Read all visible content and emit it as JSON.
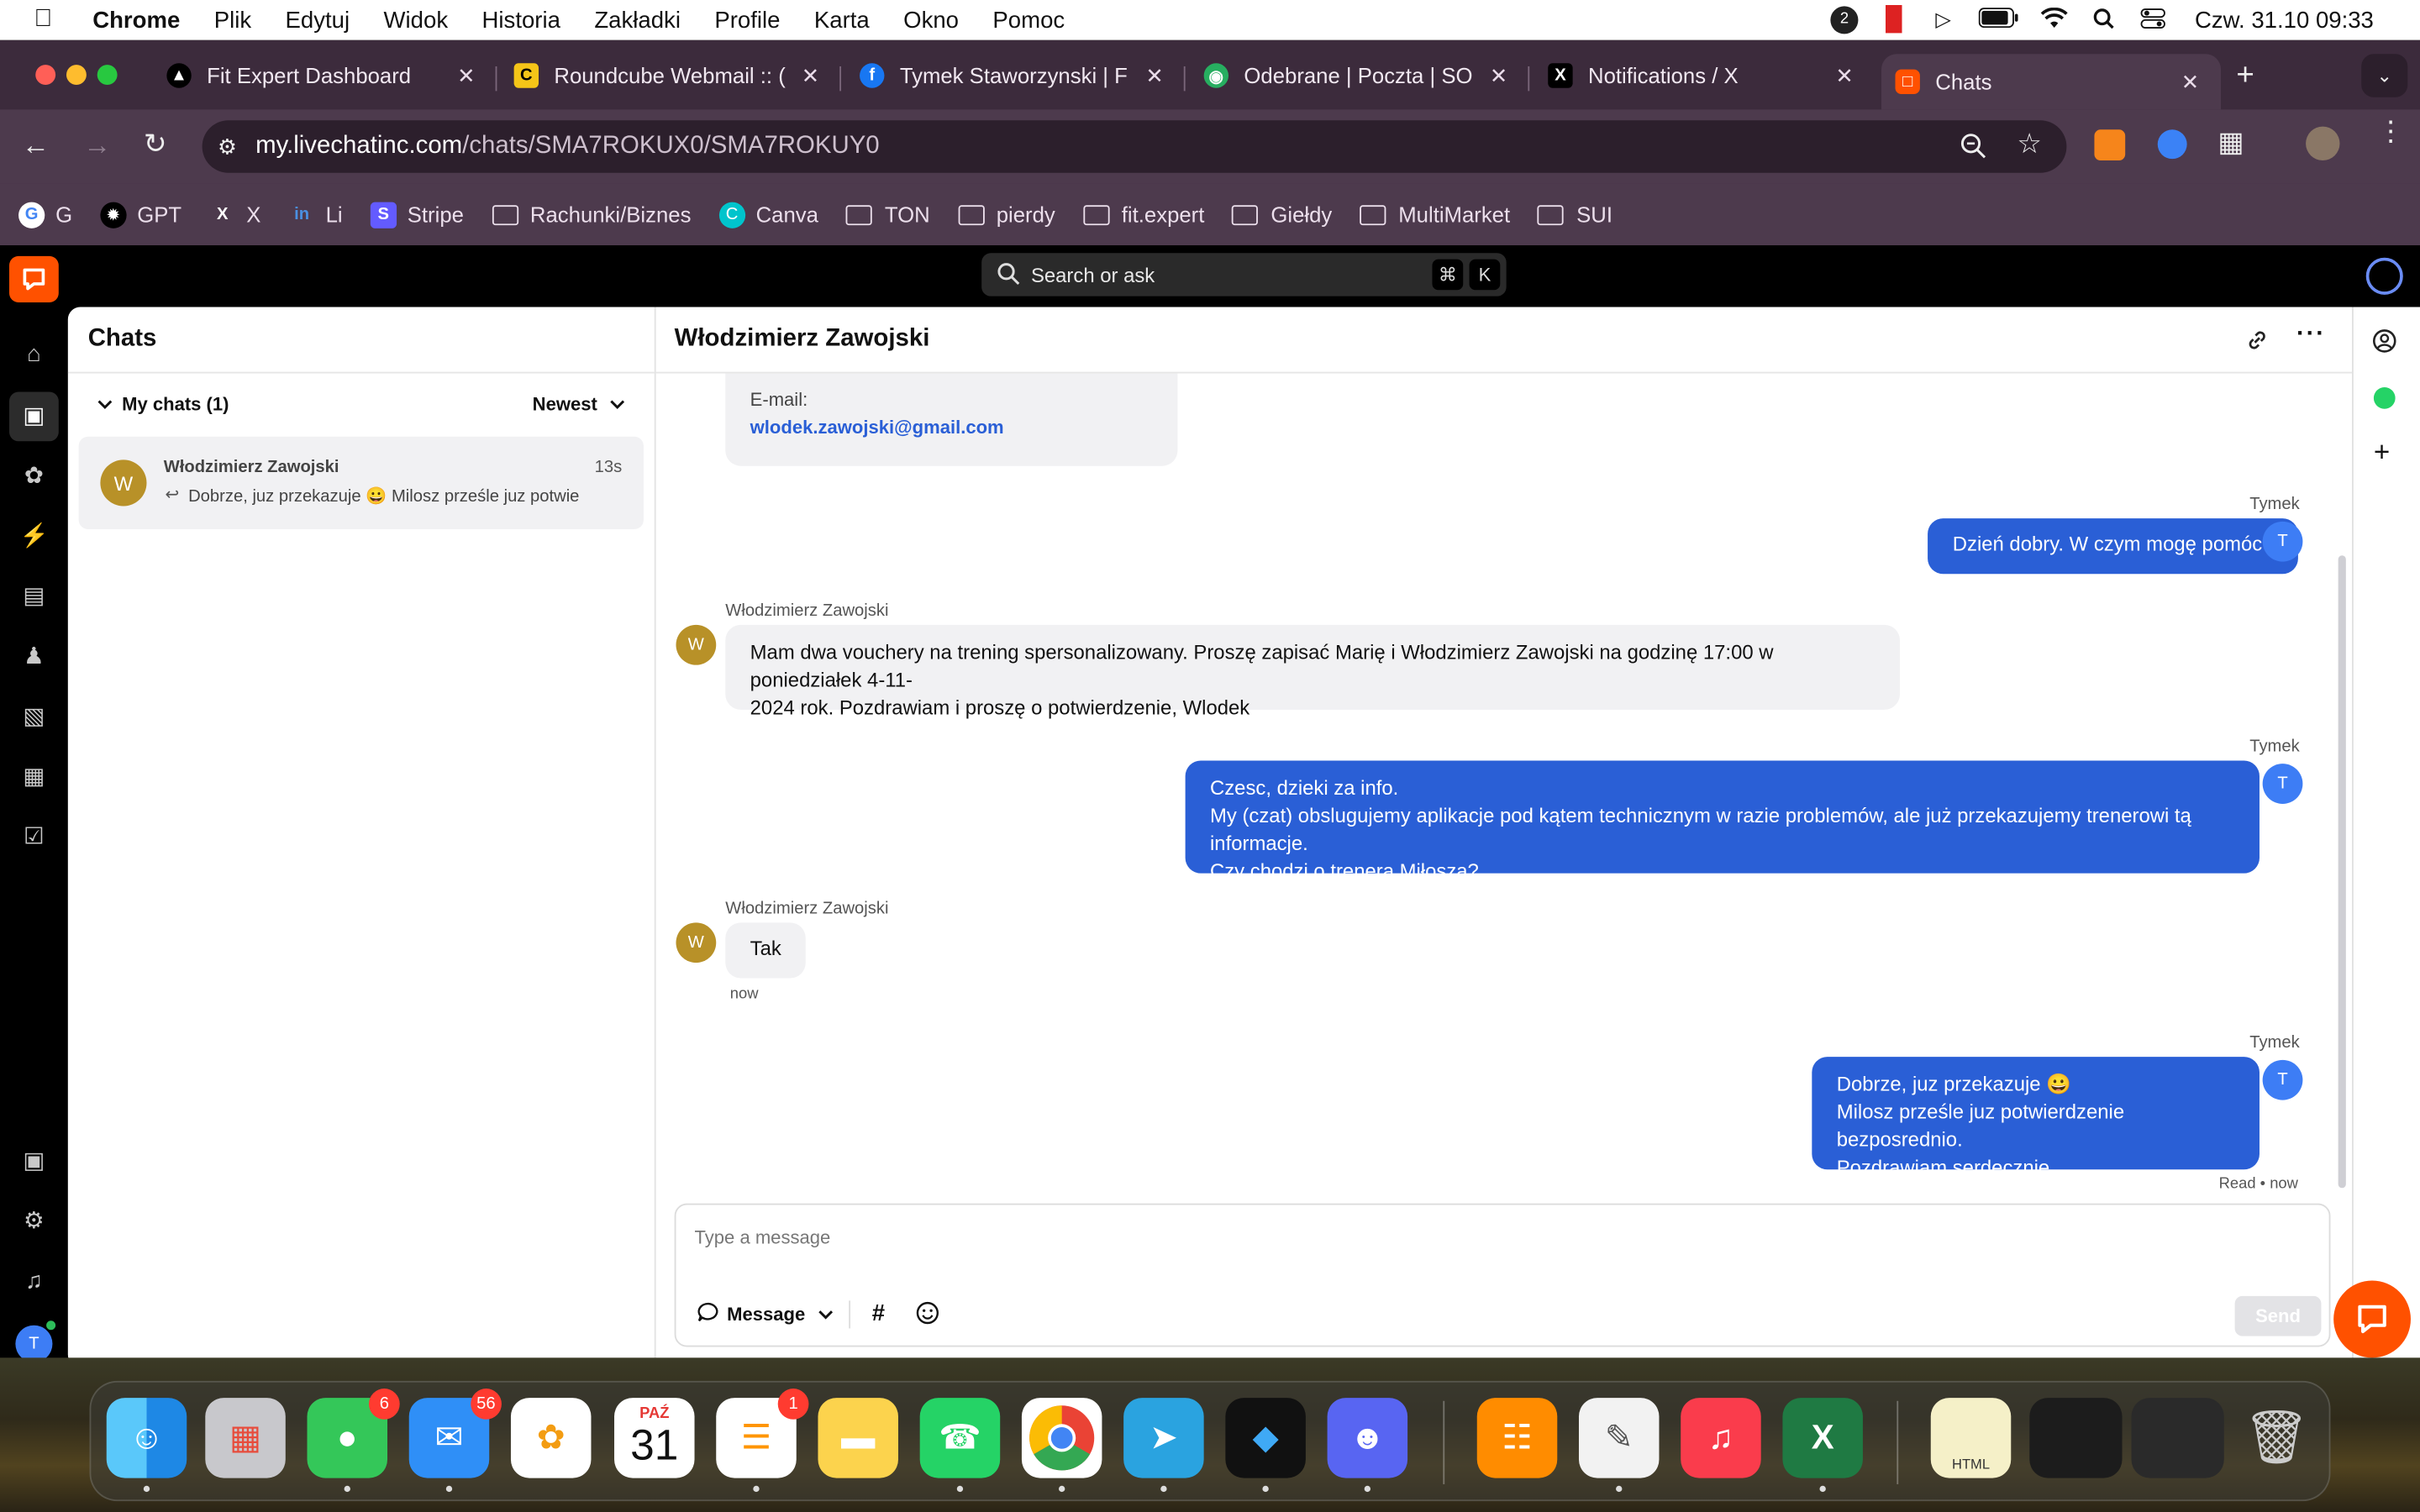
{
  "menubar": {
    "app": "Chrome",
    "items": [
      "Plik",
      "Edytuj",
      "Widok",
      "Historia",
      "Zakładki",
      "Profile",
      "Karta",
      "Okno",
      "Pomoc"
    ],
    "clock": "Czw. 31.10  09:33",
    "notif_badge": "2"
  },
  "tabs": [
    {
      "title": "Fit Expert Dashboard",
      "icon": "fitexpert-icon"
    },
    {
      "title": "Roundcube Webmail :: (",
      "icon": "roundcube-icon"
    },
    {
      "title": "Tymek Staworzynski | F",
      "icon": "facebook-icon"
    },
    {
      "title": "Odebrane | Poczta | SO",
      "icon": "mail-icon"
    },
    {
      "title": "Notifications / X",
      "icon": "x-icon"
    },
    {
      "title": "Chats",
      "icon": "livechat-icon"
    }
  ],
  "omnibox": {
    "host": "my.livechatinc.com",
    "path": "/chats/SMA7ROKUX0/SMA7ROKUY0"
  },
  "bookmarks": [
    {
      "label": "G",
      "type": "google"
    },
    {
      "label": "GPT",
      "type": "gpt"
    },
    {
      "label": "X",
      "type": "x"
    },
    {
      "label": "Li",
      "type": "linkedin"
    },
    {
      "label": "Stripe",
      "type": "stripe"
    },
    {
      "label": "Rachunki/Biznes",
      "type": "folder"
    },
    {
      "label": "Canva",
      "type": "canva"
    },
    {
      "label": "TON",
      "type": "folder"
    },
    {
      "label": "pierdy",
      "type": "folder"
    },
    {
      "label": "fit.expert",
      "type": "folder"
    },
    {
      "label": "Giełdy",
      "type": "folder"
    },
    {
      "label": "MultiMarket",
      "type": "folder"
    },
    {
      "label": "SUI",
      "type": "folder"
    }
  ],
  "search": {
    "placeholder": "Search or ask",
    "shortcut1": "⌘",
    "shortcut2": "K"
  },
  "chats_panel": {
    "title": "Chats",
    "group": "My chats (1)",
    "sort": "Newest",
    "item": {
      "initial": "W",
      "name": "Włodzimierz Zawojski",
      "time": "13s",
      "preview": "Dobrze, juz przekazuje 😀 Milosz prześle juz potwie"
    }
  },
  "conversation": {
    "title": "Włodzimierz Zawojski",
    "email_label": "E-mail:",
    "email": "wlodek.zawojski@gmail.com",
    "agent_name": "Tymek",
    "agent_initial": "T",
    "customer_name": "Włodzimierz Zawojski",
    "customer_initial": "W",
    "m1": "Dzień dobry. W czym mogę pomóc?",
    "m2a": "Mam dwa vouchery na trening spersonalizowany. Proszę zapisać Marię i Włodzimierz Zawojski na godzinę 17:00 w poniedziałek 4-11-",
    "m2b": "2024 rok. Pozdrawiam i proszę o potwierdzenie, Wlodek",
    "m3a": "Czesc, dzieki za info.",
    "m3b": "My (czat) obslugujemy aplikacje pod kątem technicznym w razie problemów, ale już przekazujemy trenerowi tą informacje.",
    "m3c": "Czy chodzi o trenera Miłosza?",
    "m4": "Tak",
    "m4_time": "now",
    "m5a": "Dobrze, juz przekazuje 😀",
    "m5b": "Milosz prześle juz potwierdzenie bezposrednio.",
    "m5c": "Pozdrawiam serdecznie",
    "m5_status": "Read • now"
  },
  "composer": {
    "placeholder": "Type a message",
    "mode": "Message",
    "send": "Send"
  },
  "dock": {
    "messages_badge": "6",
    "mail_badge": "56",
    "calendar_month": "PAŹ",
    "calendar_day": "31",
    "reminders_badge": "1",
    "file_label": "HTML"
  },
  "colors": {
    "accent": "#2a5fd6",
    "livechat_orange": "#ff5100",
    "chrome_frame": "#3c2b3c"
  }
}
